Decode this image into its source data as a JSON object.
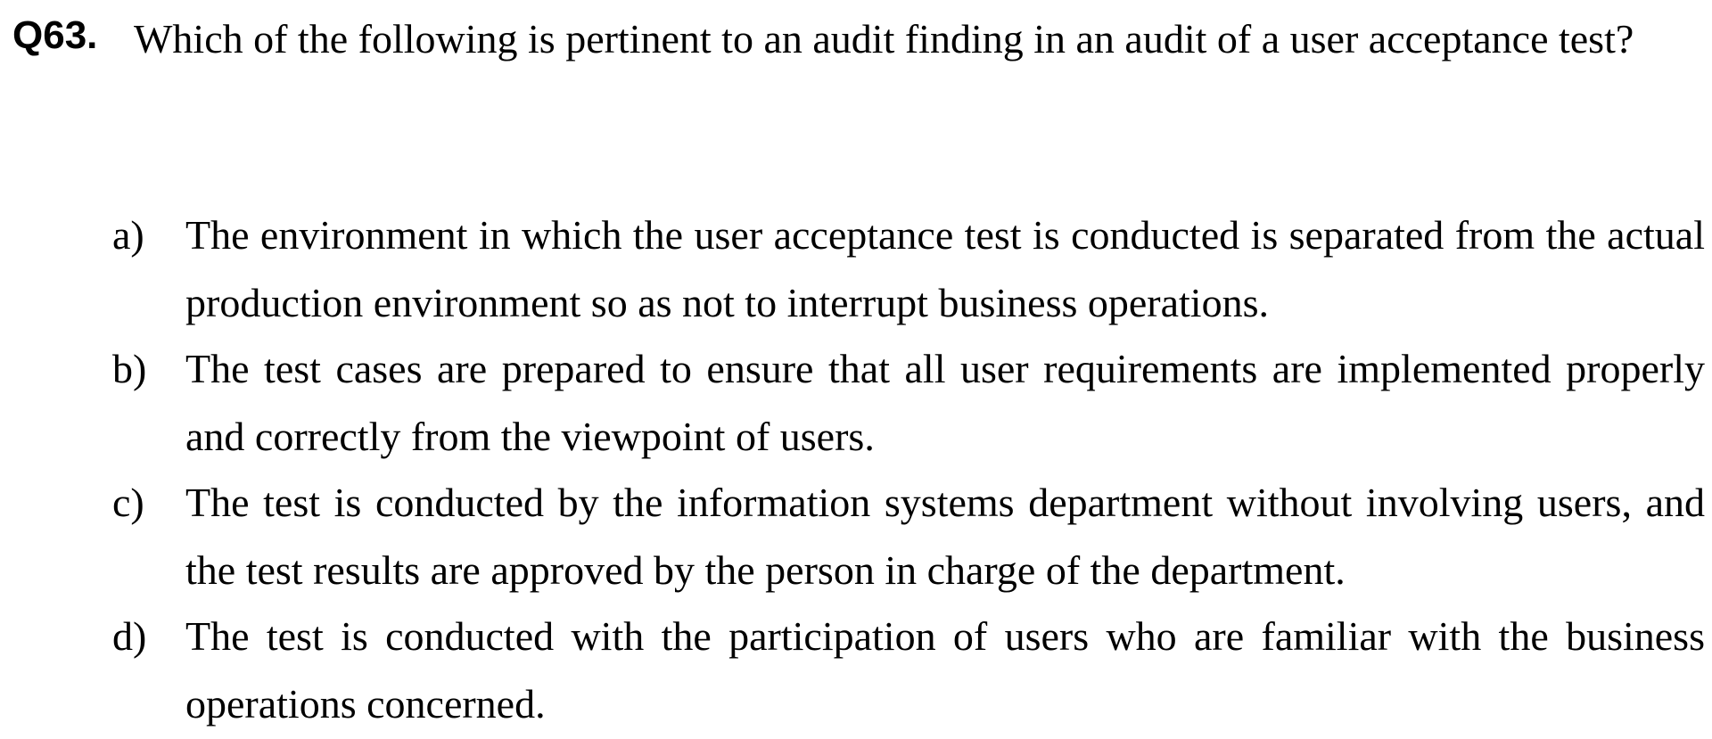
{
  "question": {
    "number": "Q63.",
    "text": "Which of the following is pertinent to an audit finding in an audit of a user acceptance test?"
  },
  "options": [
    {
      "letter": "a)",
      "text": "The environment in which the user acceptance test is conducted is separated from the actual production environment so as not to interrupt business operations."
    },
    {
      "letter": "b)",
      "text": "The test cases are prepared to ensure that all user requirements are implemented properly and correctly from the viewpoint of users."
    },
    {
      "letter": "c)",
      "text": "The test is conducted by the information systems department without involving users, and the test results are approved by the person in charge of the department."
    },
    {
      "letter": "d)",
      "text": "The test is conducted with the participation of users who are familiar with the business operations concerned."
    }
  ]
}
